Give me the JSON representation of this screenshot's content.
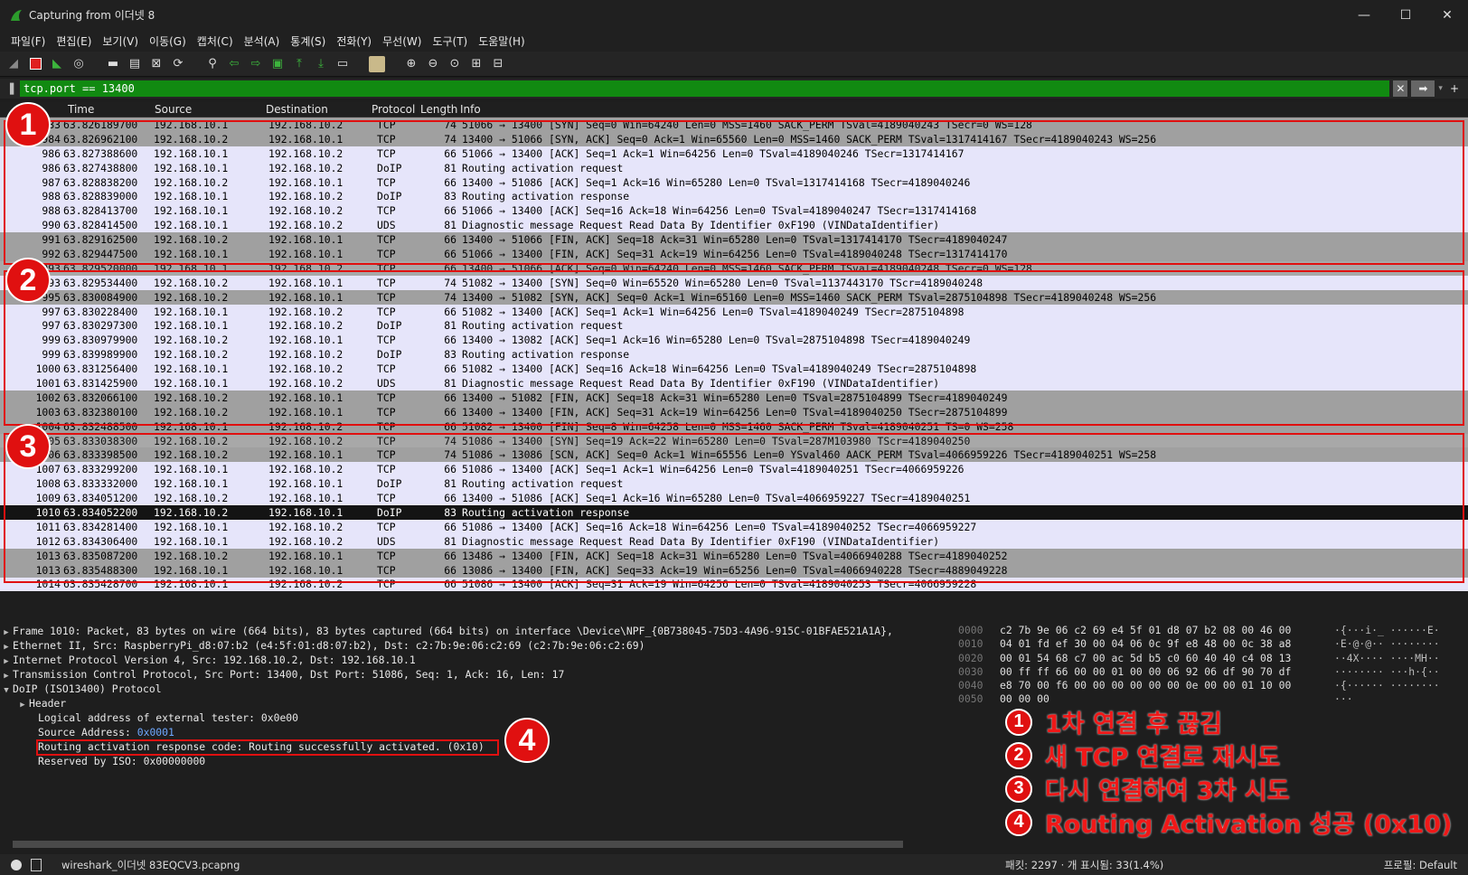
{
  "window": {
    "title": "Capturing from 이더넷 8",
    "controls": [
      "—",
      "☐",
      "✕"
    ]
  },
  "menu": [
    "파일(F)",
    "편집(E)",
    "보기(V)",
    "이동(G)",
    "캡처(C)",
    "분석(A)",
    "통계(S)",
    "전화(Y)",
    "무선(W)",
    "도구(T)",
    "도움말(H)"
  ],
  "filter": {
    "value": "tcp.port == 13400",
    "clear_glyph": "✕",
    "apply_glyph": "➡",
    "add_glyph": "+"
  },
  "columns": [
    "Time",
    "Source",
    "Destination",
    "Protocol",
    "Length",
    "Info"
  ],
  "packets": [
    {
      "no": "983",
      "time": "63.826189700",
      "src": "192.168.10.1",
      "dst": "192.168.10.2",
      "proto": "TCP",
      "len": "74",
      "info": "51066 → 13400 [SYN] Seq=0 Win=64240 Len=0 MSS=1460 SACK_PERM TSval=4189040243 TSecr=0 WS=128",
      "style": "gray"
    },
    {
      "no": "984",
      "time": "63.826962100",
      "src": "192.168.10.2",
      "dst": "192.168.10.1",
      "proto": "TCP",
      "len": "74",
      "info": "13400 → 51066 [SYN, ACK] Seq=0 Ack=1 Win=65560 Len=0 MSS=1460 SACK_PERM TSval=1317414167 TSecr=4189040243 WS=256",
      "style": "gray"
    },
    {
      "no": "986",
      "time": "63.827388600",
      "src": "192.168.10.1",
      "dst": "192.168.10.2",
      "proto": "TCP",
      "len": "66",
      "info": "51066 → 13400 [ACK] Seq=1 Ack=1 Win=64256 Len=0 TSval=4189040246 TSecr=1317414167",
      "style": "tcp"
    },
    {
      "no": "986",
      "time": "63.827438800",
      "src": "192.168.10.1",
      "dst": "192.168.10.2",
      "proto": "DoIP",
      "len": "81",
      "info": "Routing activation request",
      "style": "tcp"
    },
    {
      "no": "987",
      "time": "63.828838200",
      "src": "192.168.10.2",
      "dst": "192.168.10.1",
      "proto": "TCP",
      "len": "66",
      "info": "13400 → 51086 [ACK] Seq=1 Ack=16 Win=65280 Len=0 TSval=1317414168 TSecr=4189040246",
      "style": "tcp"
    },
    {
      "no": "988",
      "time": "63.828839000",
      "src": "192.168.10.1",
      "dst": "192.168.10.2",
      "proto": "DoIP",
      "len": "83",
      "info": "Routing activation response",
      "style": "tcp"
    },
    {
      "no": "988",
      "time": "63.828413700",
      "src": "192.168.10.1",
      "dst": "192.168.10.2",
      "proto": "TCP",
      "len": "66",
      "info": "51066 → 13400 [ACK] Seq=16 Ack=18 Win=64256 Len=0 TSval=4189040247 TSecr=1317414168",
      "style": "tcp"
    },
    {
      "no": "990",
      "time": "63.828414500",
      "src": "192.168.10.1",
      "dst": "192.168.10.2",
      "proto": "UDS",
      "len": "81",
      "info": "Diagnostic message Request   Read Data By Identifier              0xF190 (VINDataIdentifier)",
      "style": "tcp"
    },
    {
      "no": "991",
      "time": "63.829162500",
      "src": "192.168.10.2",
      "dst": "192.168.10.1",
      "proto": "TCP",
      "len": "66",
      "info": "13400 → 51066 [FIN, ACK] Seq=18 Ack=31 Win=65280 Len=0 TSval=1317414170 TSecr=4189040247",
      "style": "gray"
    },
    {
      "no": "992",
      "time": "63.829447500",
      "src": "192.168.10.1",
      "dst": "192.168.10.1",
      "proto": "TCP",
      "len": "66",
      "info": "51066 → 13400 [FIN, ACK] Seq=31 Ack=19 Win=64256 Len=0 TSval=4189040248 TSecr=1317414170",
      "style": "gray"
    },
    {
      "no": "993",
      "time": "63.829520000",
      "src": "192.168.10.1",
      "dst": "192.168.10.2",
      "proto": "TCP",
      "len": "66",
      "info": "13400 → 51066 [ACK] Seq=0 Win=64240 Len=0 MSS=1460 SACK_PERM TSval=4189040248 TSecr=0 WS=128",
      "style": "ghost"
    },
    {
      "no": "993",
      "time": "63.829534400",
      "src": "192.168.10.2",
      "dst": "192.168.10.1",
      "proto": "TCP",
      "len": "74",
      "info": "51082 → 13400 [SYN] Seq=0 Win=65520 Win=65280 Len=0 TSval=1137443170 TScr=4189040248",
      "style": "tcp"
    },
    {
      "no": "995",
      "time": "63.830084900",
      "src": "192.168.10.2",
      "dst": "192.168.10.1",
      "proto": "TCP",
      "len": "74",
      "info": "13400 → 51082 [SYN, ACK] Seq=0 Ack=1 Win=65160 Len=0 MSS=1460 SACK_PERM TSval=2875104898 TSecr=4189040248 WS=256",
      "style": "gray"
    },
    {
      "no": "997",
      "time": "63.830228400",
      "src": "192.168.10.1",
      "dst": "192.168.10.2",
      "proto": "TCP",
      "len": "66",
      "info": "51082 → 13400 [ACK] Seq=1 Ack=1 Win=64256 Len=0 TSval=4189040249 TSecr=2875104898",
      "style": "tcp"
    },
    {
      "no": "997",
      "time": "63.830297300",
      "src": "192.168.10.1",
      "dst": "192.168.10.2",
      "proto": "DoIP",
      "len": "81",
      "info": "Routing activation request",
      "style": "tcp"
    },
    {
      "no": "999",
      "time": "63.830979900",
      "src": "192.168.10.2",
      "dst": "192.168.10.1",
      "proto": "TCP",
      "len": "66",
      "info": "13400 → 13082 [ACK] Seq=1 Ack=16 Win=65280 Len=0 TSval=2875104898 TSecr=4189040249",
      "style": "tcp"
    },
    {
      "no": "999",
      "time": "63.839989900",
      "src": "192.168.10.2",
      "dst": "192.168.10.2",
      "proto": "DoIP",
      "len": "83",
      "info": "Routing activation response",
      "style": "tcp"
    },
    {
      "no": "1000",
      "time": "63.831256400",
      "src": "192.168.10.1",
      "dst": "192.168.10.2",
      "proto": "TCP",
      "len": "66",
      "info": "51082 → 13400 [ACK] Seq=16 Ack=18 Win=64256 Len=0 TSval=4189040249 TSecr=2875104898",
      "style": "tcp"
    },
    {
      "no": "1001",
      "time": "63.831425900",
      "src": "192.168.10.1",
      "dst": "192.168.10.2",
      "proto": "UDS",
      "len": "81",
      "info": "Diagnostic message Request   Read Data By Identifier              0xF190 (VINDataIdentifier)",
      "style": "tcp"
    },
    {
      "no": "1002",
      "time": "63.832066100",
      "src": "192.168.10.2",
      "dst": "192.168.10.1",
      "proto": "TCP",
      "len": "66",
      "info": "13400 → 51082 [FIN, ACK] Seq=18 Ack=31 Win=65280 Len=0 TSval=2875104899 TSecr=4189040249",
      "style": "gray"
    },
    {
      "no": "1003",
      "time": "63.832380100",
      "src": "192.168.10.2",
      "dst": "192.168.10.1",
      "proto": "TCP",
      "len": "66",
      "info": "13400 → 13400 [FIN, ACK] Seq=31 Ack=19 Win=64256 Len=0 TSval=4189040250 TSecr=2875104899",
      "style": "gray"
    },
    {
      "no": "1004",
      "time": "63.832488500",
      "src": "192.168.10.1",
      "dst": "192.168.10.2",
      "proto": "TCP",
      "len": "66",
      "info": "51082 → 13400 [FIN] Seq=8 Win=64258 Len=0 MSS=1460 SACK_PERM TSval=4189040251 TS=0 WS=258",
      "style": "gray"
    },
    {
      "no": "1005",
      "time": "63.833038300",
      "src": "192.168.10.2",
      "dst": "192.168.10.2",
      "proto": "TCP",
      "len": "74",
      "info": "51086 → 13400 [SYN] Seq=19 Ack=22 Win=65280 Len=0 TSval=287M103980 TScr=4189040250",
      "style": "ghost"
    },
    {
      "no": "1006",
      "time": "63.833398500",
      "src": "192.168.10.2",
      "dst": "192.168.10.1",
      "proto": "TCP",
      "len": "74",
      "info": "51086 → 13086 [SCN, ACK] Seq=0 Ack=1 Win=65556 Len=0 YSval460 AACK_PERM TSval=4066959226 TSecr=4189040251 WS=258",
      "style": "gray"
    },
    {
      "no": "1007",
      "time": "63.833299200",
      "src": "192.168.10.1",
      "dst": "192.168.10.2",
      "proto": "TCP",
      "len": "66",
      "info": "51086 → 13400 [ACK] Seq=1 Ack=1 Win=64256 Len=0 TSval=4189040251 TSecr=4066959226",
      "style": "tcp"
    },
    {
      "no": "1008",
      "time": "63.833332000",
      "src": "192.168.10.1",
      "dst": "192.168.10.1",
      "proto": "DoIP",
      "len": "81",
      "info": "Routing activation request",
      "style": "tcp"
    },
    {
      "no": "1009",
      "time": "63.834051200",
      "src": "192.168.10.2",
      "dst": "192.168.10.1",
      "proto": "TCP",
      "len": "66",
      "info": "13400 → 51086 [ACK] Seq=1 Ack=16 Win=65280 Len=0 TSval=4066959227 TSecr=4189040251",
      "style": "tcp"
    },
    {
      "no": "1010",
      "time": "63.834052200",
      "src": "192.168.10.2",
      "dst": "192.168.10.1",
      "proto": "DoIP",
      "len": "83",
      "info": "Routing activation response",
      "style": "sel"
    },
    {
      "no": "1011",
      "time": "63.834281400",
      "src": "192.168.10.1",
      "dst": "192.168.10.2",
      "proto": "TCP",
      "len": "66",
      "info": "51086 → 13400 [ACK] Seq=16 Ack=18 Win=64256 Len=0 TSval=4189040252 TSecr=4066959227",
      "style": "tcp"
    },
    {
      "no": "1012",
      "time": "63.834306400",
      "src": "192.168.10.1",
      "dst": "192.168.10.2",
      "proto": "UDS",
      "len": "81",
      "info": "Diagnostic message Request   Read Data By Identifier              0xF190 (VINDataIdentifier)",
      "style": "tcp"
    },
    {
      "no": "1013",
      "time": "63.835087200",
      "src": "192.168.10.2",
      "dst": "192.168.10.1",
      "proto": "TCP",
      "len": "66",
      "info": "13486 → 13400 [FIN, ACK] Seq=18 Ack=31 Win=65280 Len=0 TSval=4066940288 TSecr=4189040252",
      "style": "gray"
    },
    {
      "no": "1013",
      "time": "63.835488300",
      "src": "192.168.10.1",
      "dst": "192.168.10.1",
      "proto": "TCP",
      "len": "66",
      "info": "13086 → 13400 [FIN, ACK] Seq=33 Ack=19 Win=65256 Len=0 TSval=4066940228 TSecr=4889049228",
      "style": "gray"
    },
    {
      "no": "1014",
      "time": "63.835428700",
      "src": "192.168.10.1",
      "dst": "192.168.10.2",
      "proto": "TCP",
      "len": "66",
      "info": "51086 → 13400 [ACK] Seq=31 Ack=19 Win=64256 Len=0 TSval=4189040253 TSecr=4066959228",
      "style": "tcp"
    }
  ],
  "badges": [
    "1",
    "2",
    "3",
    "4"
  ],
  "details": {
    "frame": "Frame 1010: Packet, 83 bytes on wire (664 bits), 83 bytes captured (664 bits) on interface \\Device\\NPF_{0B738045-75D3-4A96-915C-01BFAE521A1A},",
    "ethernet": "Ethernet II, Src: RaspberryPi_d8:07:b2 (e4:5f:01:d8:07:b2), Dst: c2:7b:9e:06:c2:69 (c2:7b:9e:06:c2:69)",
    "ip": "Internet Protocol Version 4, Src: 192.168.10.2, Dst: 192.168.10.1",
    "tcp": "Transmission Control Protocol, Src Port: 13400, Dst Port: 51086, Seq: 1, Ack: 16, Len: 17",
    "doip": "DoIP (ISO13400) Protocol",
    "header": "Header",
    "logical": "Logical address of external tester: 0x0e00",
    "source_label": "Source Address: ",
    "source_value": "0x0001",
    "response_code": "Routing activation response code: Routing successfully activated. (0x10)",
    "reserved": "Reserved by ISO: 0x00000000"
  },
  "bytes": [
    {
      "off": "0000",
      "hex": "c2 7b 9e 06 c2 69 e4 5f  01 d8 07 b2 08 00 46 00",
      "asc": "·{···i·_ ······E·"
    },
    {
      "off": "0010",
      "hex": "04 01 fd ef 30 00 04 06  0c 9f e8 48 00 0c 38 a8",
      "asc": "·E·@·@·· ········"
    },
    {
      "off": "0020",
      "hex": "00 01 54 68 c7 00 ac 5d  b5 c0 60 40 40 c4 08 13",
      "asc": "··4X···· ····MH··"
    },
    {
      "off": "0030",
      "hex": "00 ff ff 66 00 00 01 00  00 06 92 06 df 90 70 df",
      "asc": "········ ···h·{··"
    },
    {
      "off": "0040",
      "hex": "e8 70 00 f6 00 00 00 00  00 00 0e 00 00 01 10 00",
      "asc": "·{······ ········"
    },
    {
      "off": "0050",
      "hex": "00 00 00",
      "asc": "···"
    }
  ],
  "legend": [
    {
      "num": "1",
      "text": "1차 연결 후 끊김"
    },
    {
      "num": "2",
      "text": "새 TCP 연결로 재시도"
    },
    {
      "num": "3",
      "text": "다시 연결하여 3차 시도"
    },
    {
      "num": "4",
      "text": "Routing Activation 성공 (0x10)"
    }
  ],
  "status": {
    "file": "wireshark_이더넷 83EQCV3.pcapng",
    "count": "패킷: 2297 · 개 표시됨: 33(1.4%)",
    "profile": "프로필: Default"
  },
  "colors": {
    "tcp_row": "#e6e5fa",
    "gray_row": "#a0a0a0",
    "selected_row": "#141414",
    "filter_bg": "#118a11",
    "highlight_red": "#e01010"
  }
}
